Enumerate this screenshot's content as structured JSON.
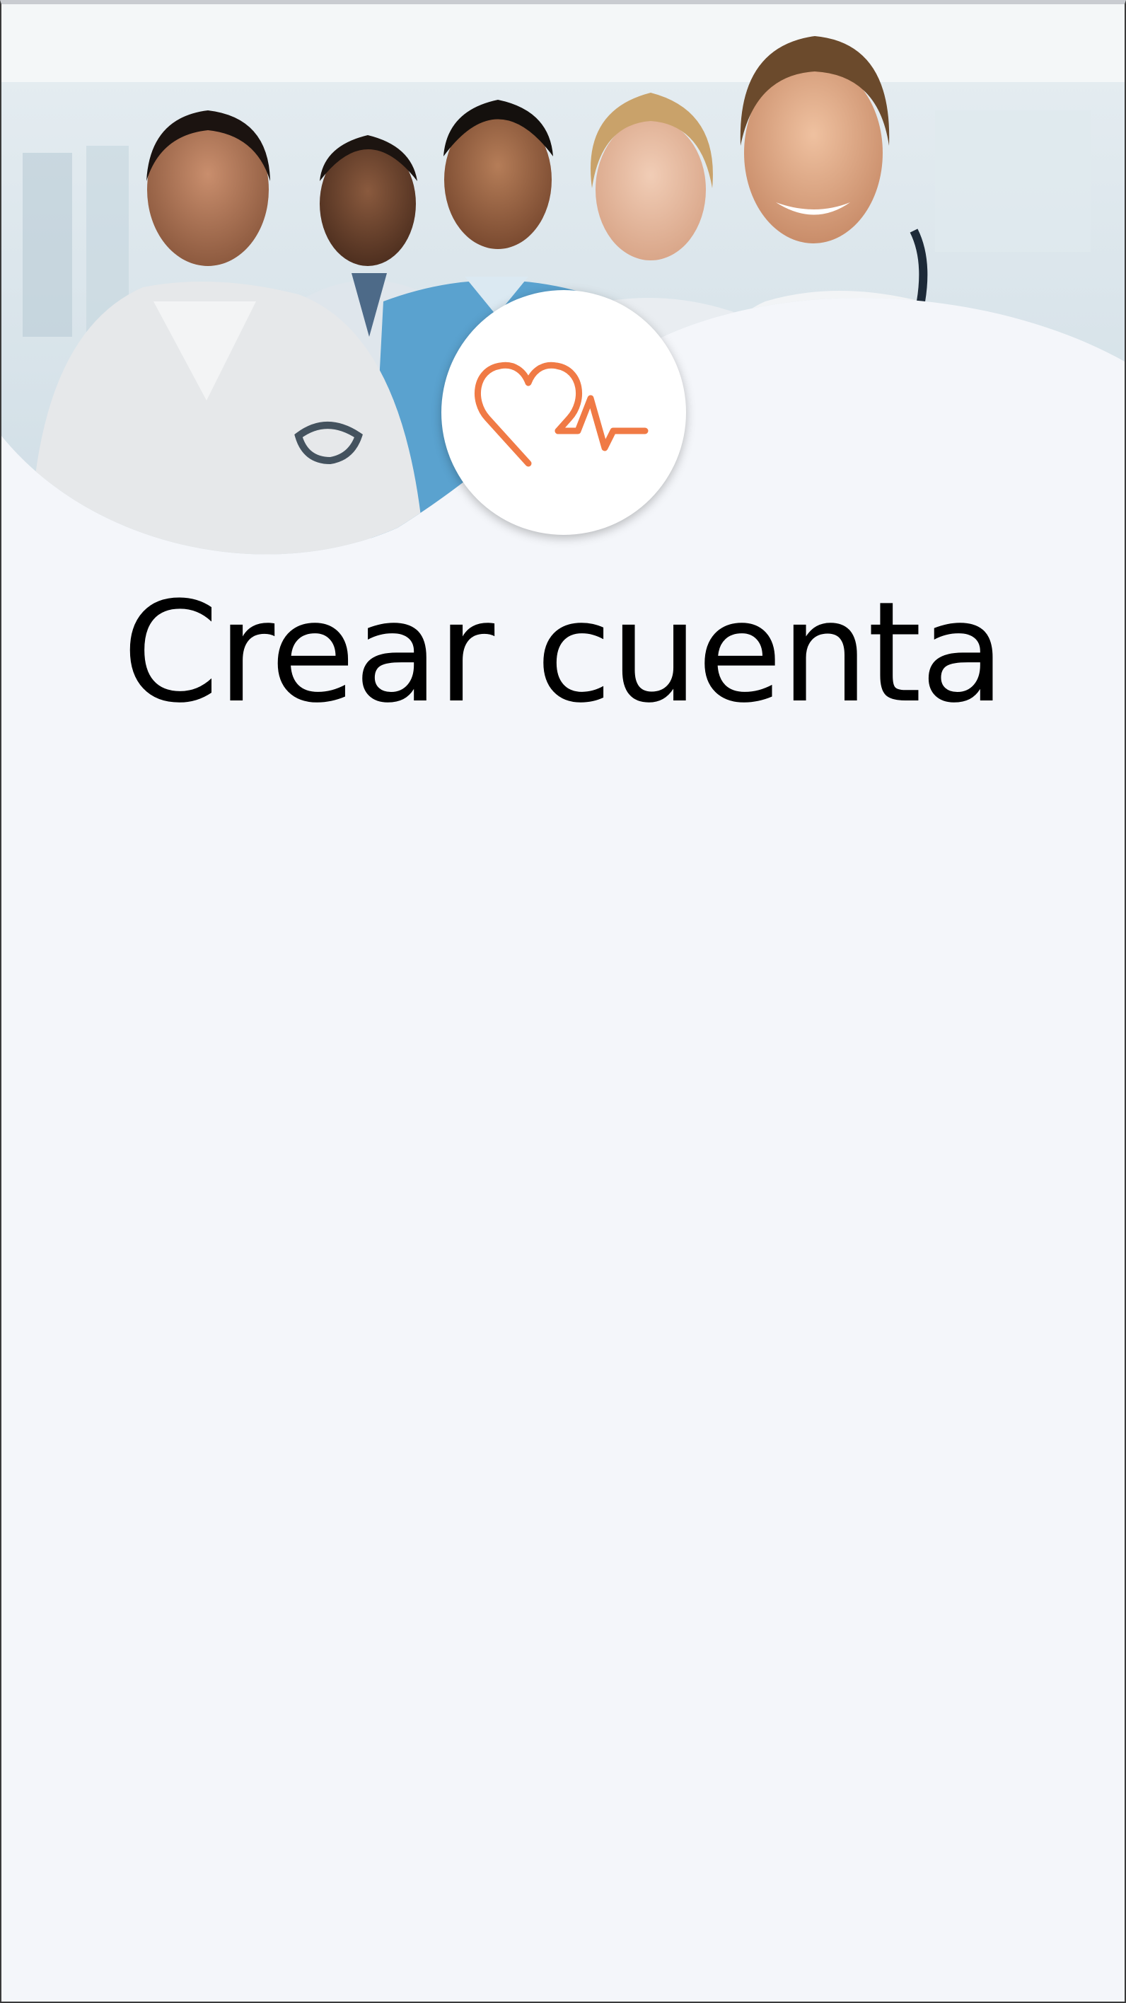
{
  "screen": {
    "title": "Crear cuenta"
  },
  "hero": {
    "image": "medical-team-photo",
    "logo_icon": "heart-pulse-icon"
  },
  "colors": {
    "background": "#f4f6fa",
    "accent": "#f07a45",
    "title": "#000000",
    "badge": "#ffffff"
  }
}
